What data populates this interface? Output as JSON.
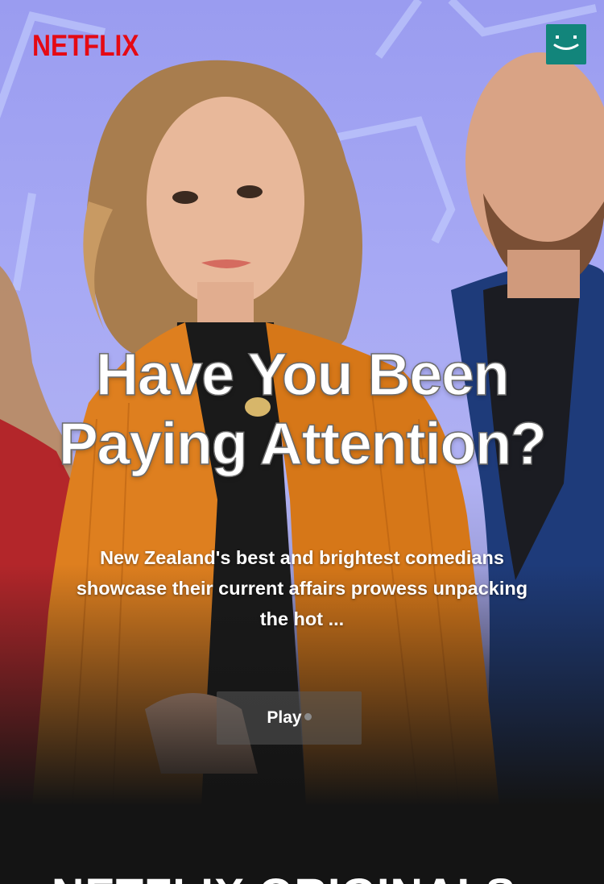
{
  "header": {
    "logo_text": "NETFLIX",
    "profile_icon": "smiley-profile-icon"
  },
  "hero": {
    "title": "Have You Been Paying Attention?",
    "description": "New Zealand's best and brightest comedians showcase their current affairs prowess unpacking the hot ...",
    "play_label": "Play"
  },
  "sections": {
    "originals_heading": "NETFLIX ORIGINALS"
  },
  "colors": {
    "brand_red": "#e50914",
    "profile_teal": "#12857b",
    "background": "#141414",
    "hero_lavender": "#a7a9f4"
  }
}
